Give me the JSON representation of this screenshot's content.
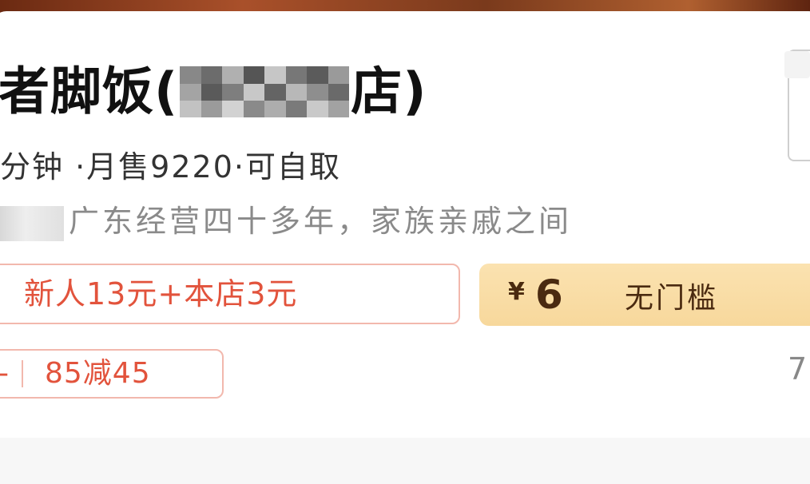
{
  "store": {
    "title_prefix": "者脚饭(",
    "title_suffix": "店)",
    "meta": "分钟 ·月售9220·可自取",
    "description": "广东经营四十多年，家族亲戚之间"
  },
  "coupons": {
    "new_user": "新人13元+本店3元",
    "currency": "¥",
    "amount": "6",
    "condition": "无门槛",
    "discount_dash": "-",
    "discount": "85减45"
  },
  "right_partial": "7",
  "colors": {
    "accent_red": "#e2533c",
    "coupon_gold": "#f7d89c"
  }
}
